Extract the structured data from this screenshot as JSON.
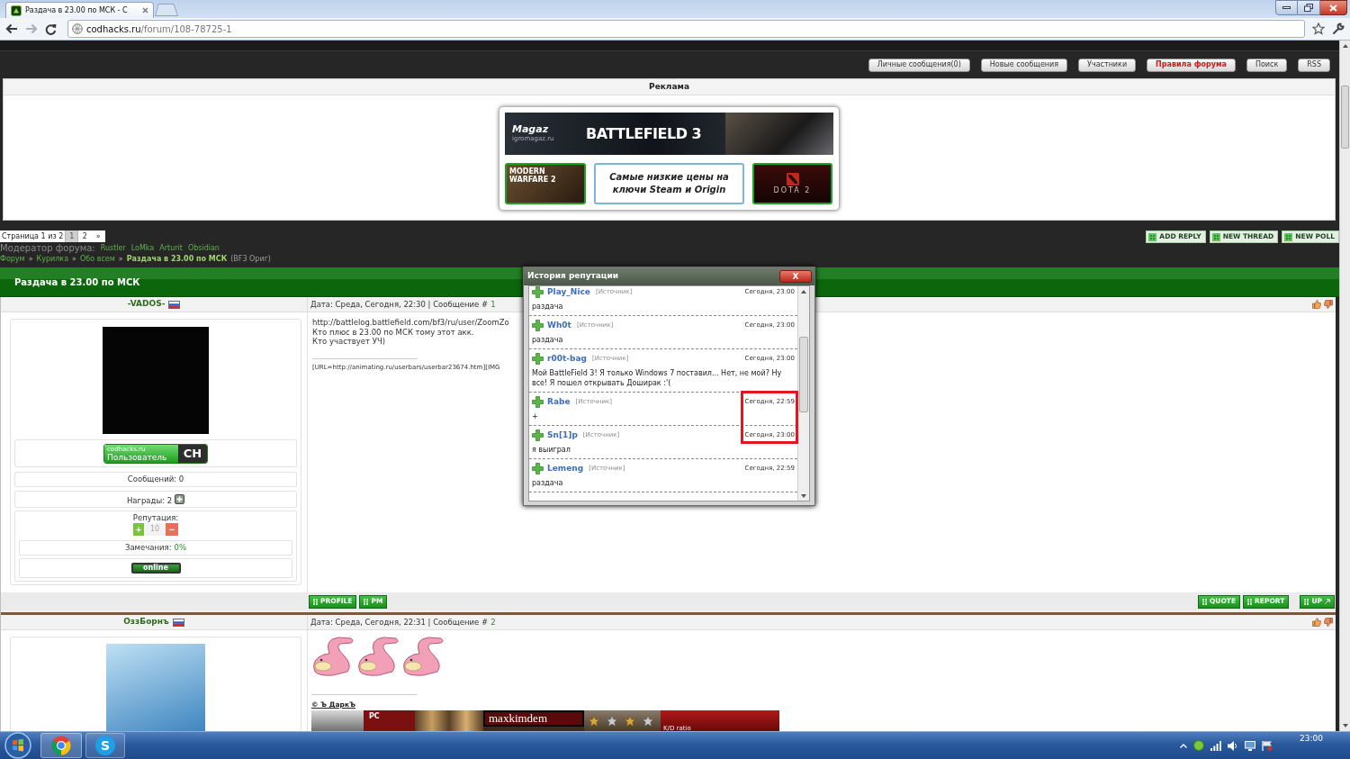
{
  "browser": {
    "tab_title": "Раздача в 23.00 по МСК - C",
    "url_host": "codhacks.ru",
    "url_path": "/forum/108-78725-1"
  },
  "top_nav": [
    {
      "label": "Личные сообщения(0)",
      "kind": "normal"
    },
    {
      "label": "Новые сообщения",
      "kind": "normal"
    },
    {
      "label": "Участники",
      "kind": "normal"
    },
    {
      "label": "Правила форума",
      "kind": "alert"
    },
    {
      "label": "Поиск",
      "kind": "normal"
    },
    {
      "label": "RSS",
      "kind": "normal"
    }
  ],
  "ad": {
    "heading": "Реклама",
    "logo": "Magaz",
    "site": "igromagaz.ru",
    "game_title": "BATTLEFIELD 3",
    "left_game": "MODERN WARFARE 2",
    "promo": "Самые низкие цены на ключи Steam и Origin",
    "right_game": "DOTA 2"
  },
  "pagination": {
    "label": "Страница 1 из 2",
    "pages": [
      {
        "label": "1",
        "selected": true
      },
      {
        "label": "2",
        "selected": false
      }
    ],
    "next": "»"
  },
  "moderators": {
    "label": "Модератор форума:",
    "names": [
      "Rustler",
      "LoMka",
      "Arturit",
      "Obsidian"
    ]
  },
  "breadcrumbs": {
    "links": [
      "Форум",
      "Курилка",
      "Обо всем"
    ],
    "separator": "»",
    "current": "Раздача в 23.00 по МСК",
    "suffix": "(BF3 Ориг)"
  },
  "thread_actions": [
    "ADD REPLY",
    "NEW THREAD",
    "NEW POLL"
  ],
  "thread_title": "Раздача в 23.00 по МСК",
  "posts": [
    {
      "kind": "text",
      "author": "-VADOS-",
      "meta": "Дата: Среда, Сегодня, 22:30 | Сообщение #",
      "number": "1",
      "body": [
        "http://battlelog.battlefield.com/bf3/ru/user/ZoomZo",
        "Кто плюс в 23.00 по МСК тому этот акк.",
        "Кто участвует УЧ)"
      ],
      "signature": "[URL=http://animating.ru/userbars/userbar23674.htm][IMG",
      "profile": {
        "rank_site": "codhacks.ru",
        "rank_title": "Пользователь",
        "rank_logo": "CH",
        "messages": "Сообщений: 0",
        "awards": "Награды: 2",
        "reputation_label": "Репутация:",
        "rep_plus": "+",
        "rep_value": "10",
        "rep_minus": "−",
        "warnings_label": "Замечания:",
        "warnings_value": "0%",
        "status": "online"
      },
      "actions_left": [
        "PROFILE",
        "PM"
      ],
      "actions_right": [
        "QUOTE",
        "REPORT"
      ],
      "up": "UP"
    },
    {
      "kind": "stickers",
      "author": "ОззБорнъ",
      "meta": "Дата: Среда, Сегодня, 22:31 | Сообщение #",
      "number": "2",
      "signature": "© Ъ ДаркЪ",
      "userbar": {
        "platform": "PC",
        "name": "maxkimdem",
        "stat_label": "K/D ratio"
      }
    }
  ],
  "popup": {
    "title": "История репутации",
    "close": "X",
    "entries": [
      {
        "name": "Play_Nice",
        "source": "[Источник]",
        "time": "Сегодня, 23:00",
        "text": "раздача"
      },
      {
        "name": "Wh0t",
        "source": "[Источник]",
        "time": "Сегодня, 23:00",
        "text": "раздача"
      },
      {
        "name": "r00t-bag",
        "source": "[Источник]",
        "time": "Сегодня, 23:00",
        "text": "Мой BattleField 3! Я только Windows 7 поставил... Нет, не мой? Ну все! Я пошел открывать Доширак :'("
      },
      {
        "name": "Rabe",
        "source": "[Источник]",
        "time": "Сегодня, 22:59",
        "text": "+"
      },
      {
        "name": "Sn[1]p",
        "source": "[Источник]",
        "time": "Сегодня, 23:00",
        "text": "я выиграл"
      },
      {
        "name": "Lemeng",
        "source": "[Источник]",
        "time": "Сегодня, 22:59",
        "text": "раздача"
      }
    ]
  },
  "taskbar": {
    "app_letter": "S",
    "clock": "23:00"
  }
}
